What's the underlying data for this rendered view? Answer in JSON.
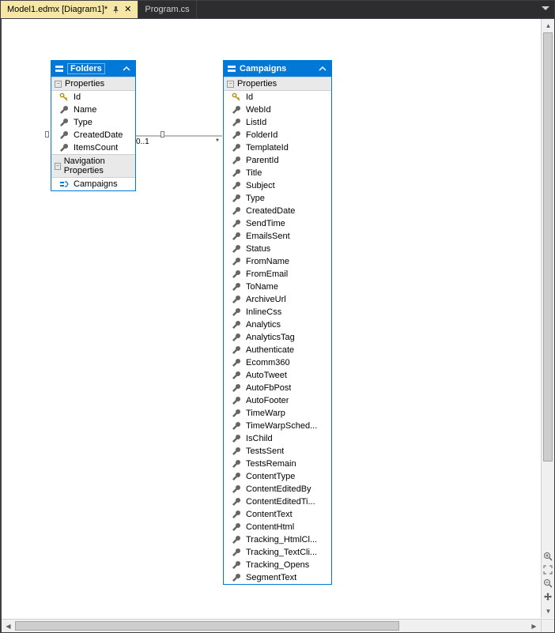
{
  "tabs": [
    {
      "label": "Model1.edmx [Diagram1]*",
      "active": true,
      "pinned": true,
      "closable": true
    },
    {
      "label": "Program.cs",
      "active": false,
      "pinned": false,
      "closable": false
    }
  ],
  "entities": {
    "folders": {
      "title": "Folders",
      "section_props": "Properties",
      "section_nav": "Navigation Properties",
      "properties": [
        {
          "label": "Id",
          "key": true
        },
        {
          "label": "Name",
          "key": false
        },
        {
          "label": "Type",
          "key": false
        },
        {
          "label": "CreatedDate",
          "key": false
        },
        {
          "label": "ItemsCount",
          "key": false
        }
      ],
      "navprops": [
        {
          "label": "Campaigns"
        }
      ]
    },
    "campaigns": {
      "title": "Campaigns",
      "section_props": "Properties",
      "properties": [
        {
          "label": "Id",
          "key": true
        },
        {
          "label": "WebId",
          "key": false
        },
        {
          "label": "ListId",
          "key": false
        },
        {
          "label": "FolderId",
          "key": false
        },
        {
          "label": "TemplateId",
          "key": false
        },
        {
          "label": "ParentId",
          "key": false
        },
        {
          "label": "Title",
          "key": false
        },
        {
          "label": "Subject",
          "key": false
        },
        {
          "label": "Type",
          "key": false
        },
        {
          "label": "CreatedDate",
          "key": false
        },
        {
          "label": "SendTime",
          "key": false
        },
        {
          "label": "EmailsSent",
          "key": false
        },
        {
          "label": "Status",
          "key": false
        },
        {
          "label": "FromName",
          "key": false
        },
        {
          "label": "FromEmail",
          "key": false
        },
        {
          "label": "ToName",
          "key": false
        },
        {
          "label": "ArchiveUrl",
          "key": false
        },
        {
          "label": "InlineCss",
          "key": false
        },
        {
          "label": "Analytics",
          "key": false
        },
        {
          "label": "AnalyticsTag",
          "key": false
        },
        {
          "label": "Authenticate",
          "key": false
        },
        {
          "label": "Ecomm360",
          "key": false
        },
        {
          "label": "AutoTweet",
          "key": false
        },
        {
          "label": "AutoFbPost",
          "key": false
        },
        {
          "label": "AutoFooter",
          "key": false
        },
        {
          "label": "TimeWarp",
          "key": false
        },
        {
          "label": "TimeWarpSched...",
          "key": false
        },
        {
          "label": "IsChild",
          "key": false
        },
        {
          "label": "TestsSent",
          "key": false
        },
        {
          "label": "TestsRemain",
          "key": false
        },
        {
          "label": "ContentType",
          "key": false
        },
        {
          "label": "ContentEditedBy",
          "key": false
        },
        {
          "label": "ContentEditedTi...",
          "key": false
        },
        {
          "label": "ContentText",
          "key": false
        },
        {
          "label": "ContentHtml",
          "key": false
        },
        {
          "label": "Tracking_HtmlCl...",
          "key": false
        },
        {
          "label": "Tracking_TextCli...",
          "key": false
        },
        {
          "label": "Tracking_Opens",
          "key": false
        },
        {
          "label": "SegmentText",
          "key": false
        }
      ]
    }
  },
  "association": {
    "left_mult": "0..1",
    "right_mult": "*"
  }
}
